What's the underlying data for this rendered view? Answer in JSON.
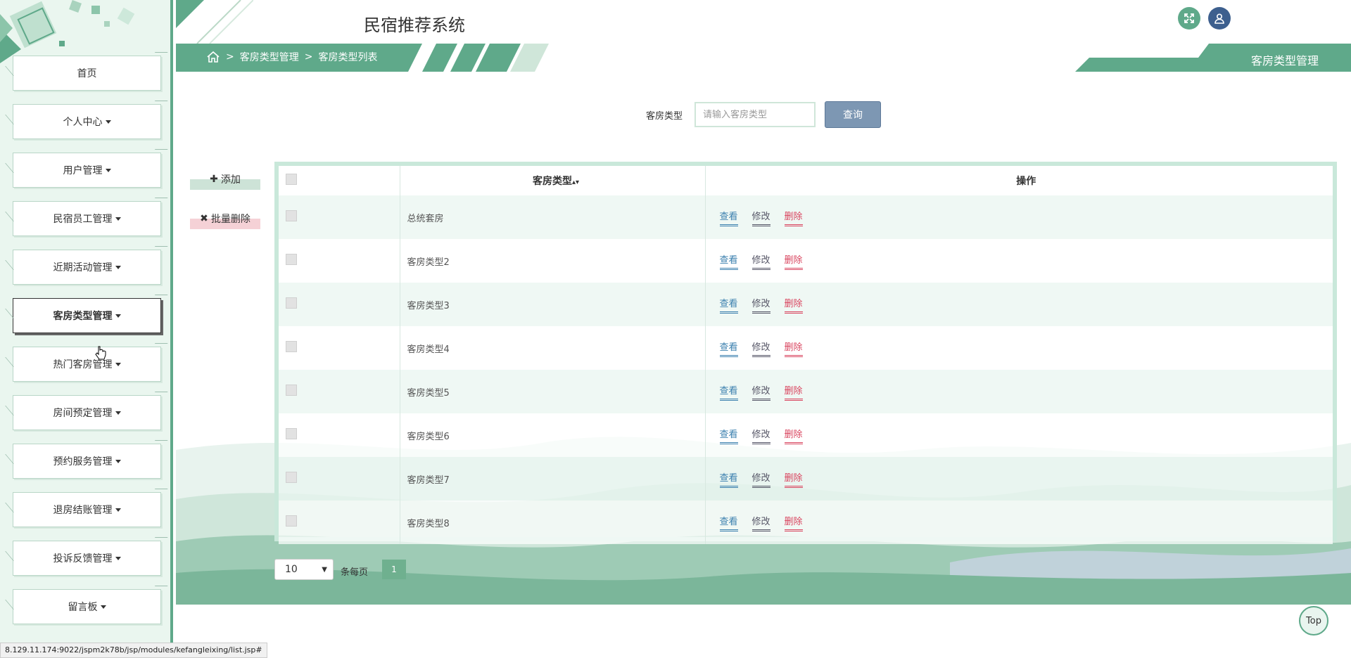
{
  "header": {
    "site_title": "民宿推荐系统",
    "page_tag": "客房类型管理"
  },
  "breadcrumb": {
    "sep1": ">",
    "level1": "客房类型管理",
    "sep2": ">",
    "level2": "客房类型列表"
  },
  "sidebar": {
    "items": [
      {
        "label": "首页",
        "has_caret": false
      },
      {
        "label": "个人中心",
        "has_caret": true
      },
      {
        "label": "用户管理",
        "has_caret": true
      },
      {
        "label": "民宿员工管理",
        "has_caret": true
      },
      {
        "label": "近期活动管理",
        "has_caret": true
      },
      {
        "label": "客房类型管理",
        "has_caret": true,
        "active": true
      },
      {
        "label": "热门客房管理",
        "has_caret": true
      },
      {
        "label": "房间预定管理",
        "has_caret": true
      },
      {
        "label": "预约服务管理",
        "has_caret": true
      },
      {
        "label": "退房结账管理",
        "has_caret": true
      },
      {
        "label": "投诉反馈管理",
        "has_caret": true
      },
      {
        "label": "留言板",
        "has_caret": true
      }
    ]
  },
  "search": {
    "label": "客房类型",
    "placeholder": "请输入客房类型",
    "button": "查询"
  },
  "actions": {
    "add": "添加",
    "bulk_delete": "批量删除"
  },
  "table": {
    "headers": {
      "type": "客房类型",
      "ops": "操作"
    },
    "ops": {
      "view": "查看",
      "edit": "修改",
      "delete": "删除"
    },
    "rows": [
      {
        "type": "总统套房"
      },
      {
        "type": "客房类型2"
      },
      {
        "type": "客房类型3"
      },
      {
        "type": "客房类型4"
      },
      {
        "type": "客房类型5"
      },
      {
        "type": "客房类型6"
      },
      {
        "type": "客房类型7"
      },
      {
        "type": "客房类型8"
      }
    ]
  },
  "pagination": {
    "page_size": "10",
    "per_page_label": "条每页",
    "current_page": "1"
  },
  "back_to_top": "Top",
  "status_url": "8.129.11.174:9022/jspm2k78b/jsp/modules/kefangleixing/list.jsp#",
  "colors": {
    "primary": "#5fa98a",
    "user_icon": "#3d5f8e",
    "search_button": "#7d97b3",
    "delete": "#d9455f",
    "view": "#3a7fae"
  }
}
